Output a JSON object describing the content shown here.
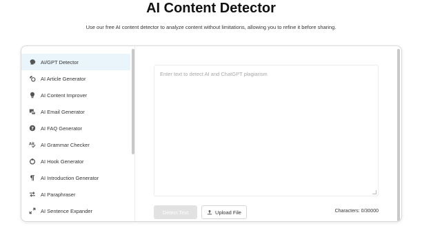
{
  "page": {
    "title": "AI Content Detector",
    "subtitle": "Use our free AI content detector to analyze content without limitations, allowing you to refine it before sharing."
  },
  "sidebar": {
    "items": [
      {
        "label": "AI/GPT Detector",
        "icon": "brain-icon",
        "active": true
      },
      {
        "label": "AI Article Generator",
        "icon": "article-icon",
        "active": false
      },
      {
        "label": "AI Content Improver",
        "icon": "lightbulb-icon",
        "active": false
      },
      {
        "label": "AI Email Generator",
        "icon": "email-icon",
        "active": false
      },
      {
        "label": "AI FAQ Generator",
        "icon": "question-icon",
        "active": false
      },
      {
        "label": "AI Grammar Checker",
        "icon": "spellcheck-icon",
        "active": false
      },
      {
        "label": "AI Hook Generator",
        "icon": "hook-icon",
        "active": false
      },
      {
        "label": "AI Introduction Generator",
        "icon": "paragraph-icon",
        "active": false
      },
      {
        "label": "AI Paraphraser",
        "icon": "swap-icon",
        "active": false
      },
      {
        "label": "AI Sentence Expander",
        "icon": "expand-icon",
        "active": false
      }
    ]
  },
  "editor": {
    "placeholder": "Enter text to detect AI and ChatGPT plagiarism",
    "value": ""
  },
  "actions": {
    "detect_label": "Detect Text",
    "upload_label": "Upload File",
    "upload_icon": "upload-icon"
  },
  "counter": {
    "text": "Characters: 0/30000"
  },
  "colors": {
    "active_item_bg": "#e9f4fb",
    "icon": "#555555",
    "detect_button_bg": "#e2e2e2"
  }
}
